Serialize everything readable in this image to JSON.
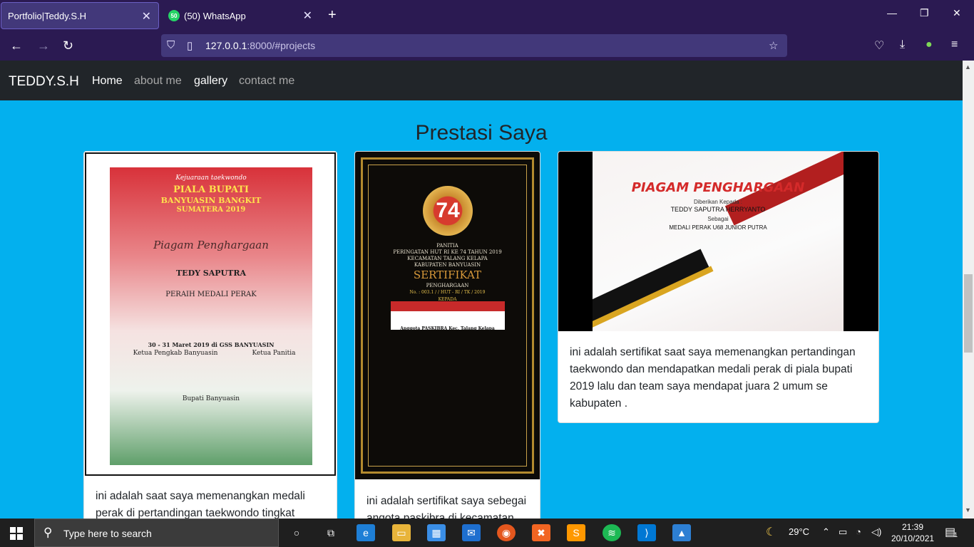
{
  "browser": {
    "tabs": [
      {
        "label": "Portfolio|Teddy.S.H",
        "active": true
      },
      {
        "label": "(50) WhatsApp",
        "badge": "50",
        "active": false
      }
    ],
    "url_host": "127.0.0.1",
    "url_rest": ":8000/#projects"
  },
  "site": {
    "brand": "TEDDY.S.H",
    "nav": [
      "Home",
      "about me",
      "gallery",
      "contact me"
    ],
    "section_title": "Prestasi Saya",
    "cards": [
      {
        "text": "ini adalah saat saya memenangkan medali perak di pertandingan taekwondo tingkat"
      },
      {
        "text": "ini adalah sertifikat saya sebegai angota paskibra di kecamatan"
      },
      {
        "text": "ini adalah sertifikat saat saya memenangkan pertandingan taekwondo dan mendapatkan medali perak di piala bupati 2019 lalu dan team saya mendapat juara 2 umum se kabupaten ."
      }
    ],
    "cert1": {
      "l1": "Kejuaraan taekwondo",
      "l2": "PIALA BUPATI",
      "l3": "BANYUASIN BANGKIT",
      "l4": "SUMATERA 2019",
      "l5": "Piagam Penghargaan",
      "l6": "TEDY SAPUTRA",
      "l7": "PERAIH MEDALI PERAK",
      "l8": "30 - 31 Maret 2019 di GSS BANYUASIN",
      "l9": "Ketua Pengkab Banyuasin",
      "l10": "Ketua Panitia",
      "l11": "Bupati Banyuasin"
    },
    "cert2": {
      "medal": "74",
      "l1": "PANITIA",
      "l2": "PERINGATAN HUT RI KE 74 TAHUN 2019",
      "l3": "KECAMATAN TALANG KELAPA",
      "l4": "KABUPATEN BANYUASIN",
      "l5": "SERTIFIKAT",
      "l6": "PENGHARGAAN",
      "l7": "No. : 003.1 /          / HUT - RI / TK / 2019",
      "l8": "KEPADA",
      "l9": "Anggota PASKIBRA Kec. Talang Kelapa"
    },
    "cert3": {
      "l1": "PIAGAM PENGHARGAAN",
      "l2": "Diberikan Kepada :",
      "l3": "TEDDY SAPUTRA HERRYANTO",
      "l4": "Sebagai",
      "l5": "MEDALI PERAK U68 JUNIOR PUTRA"
    }
  },
  "taskbar": {
    "search_placeholder": "Type here to search",
    "weather": "29°C",
    "time": "21:39",
    "date": "20/10/2021",
    "notifications": "1"
  }
}
